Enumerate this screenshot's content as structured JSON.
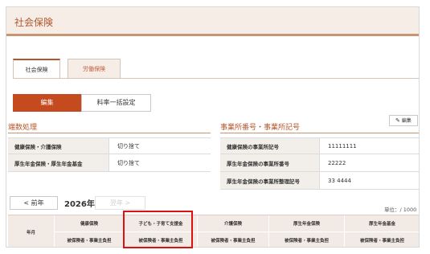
{
  "header": {
    "title": "社会保険"
  },
  "tabs": [
    {
      "label": "社会保険",
      "active": true
    },
    {
      "label": "労働保険",
      "active": false
    }
  ],
  "toolbar": {
    "edit_label": "編集",
    "bulk_label": "料率一括設定"
  },
  "rounding": {
    "title": "端数処理",
    "rows": [
      {
        "label": "健康保険・介護保険",
        "value": "切り捨て"
      },
      {
        "label": "厚生年金保険・厚生年金基金",
        "value": "切り捨て"
      }
    ]
  },
  "office": {
    "title": "事業所番号・事業所記号",
    "edit_label": "編集",
    "rows": [
      {
        "label": "健康保険の事業所記号",
        "value": "11111111"
      },
      {
        "label": "厚生年金保険の事業所番号",
        "value": "22222"
      },
      {
        "label": "厚生年金保険の事業所整理記号",
        "value": "33 4444"
      }
    ]
  },
  "year_nav": {
    "prev_label": "< 前年",
    "year": "2026年",
    "next_label": "翌年 >"
  },
  "unit_label": "単位：/ 1000",
  "table": {
    "row_header": "年月",
    "columns": [
      {
        "group": "健康保険",
        "sub": "被保険者・事業主負担"
      },
      {
        "group": "子ども・子育て支援金",
        "sub": "被保険者・事業主負担"
      },
      {
        "group": "介護保険",
        "sub": "被保険者・事業主負担"
      },
      {
        "group": "厚生年金保険",
        "sub": "被保険者・事業主負担"
      },
      {
        "group": "厚生年金基金",
        "sub": "被保険者・事業主負担"
      }
    ]
  },
  "colors": {
    "accent": "#c64a1f",
    "title": "#b3562c",
    "highlight": "#e01010"
  }
}
